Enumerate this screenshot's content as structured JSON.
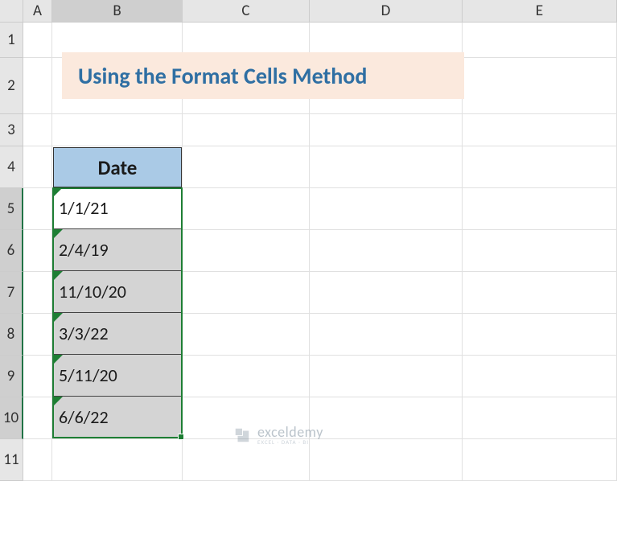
{
  "columns": [
    "A",
    "B",
    "C",
    "D",
    "E"
  ],
  "rows": [
    "1",
    "2",
    "3",
    "4",
    "5",
    "6",
    "7",
    "8",
    "9",
    "10",
    "11"
  ],
  "title": "Using the Format Cells Method",
  "table": {
    "header": "Date",
    "values": [
      "1/1/21",
      "2/4/19",
      "11/10/20",
      "3/3/22",
      "5/11/20",
      "6/6/22"
    ]
  },
  "watermark": {
    "brand": "exceldemy",
    "tagline": "EXCEL · DATA · BI"
  },
  "chart_data": {
    "type": "table",
    "title": "Date",
    "categories": [
      "B5",
      "B6",
      "B7",
      "B8",
      "B9",
      "B10"
    ],
    "values": [
      "1/1/21",
      "2/4/19",
      "11/10/20",
      "3/3/22",
      "5/11/20",
      "6/6/22"
    ]
  }
}
